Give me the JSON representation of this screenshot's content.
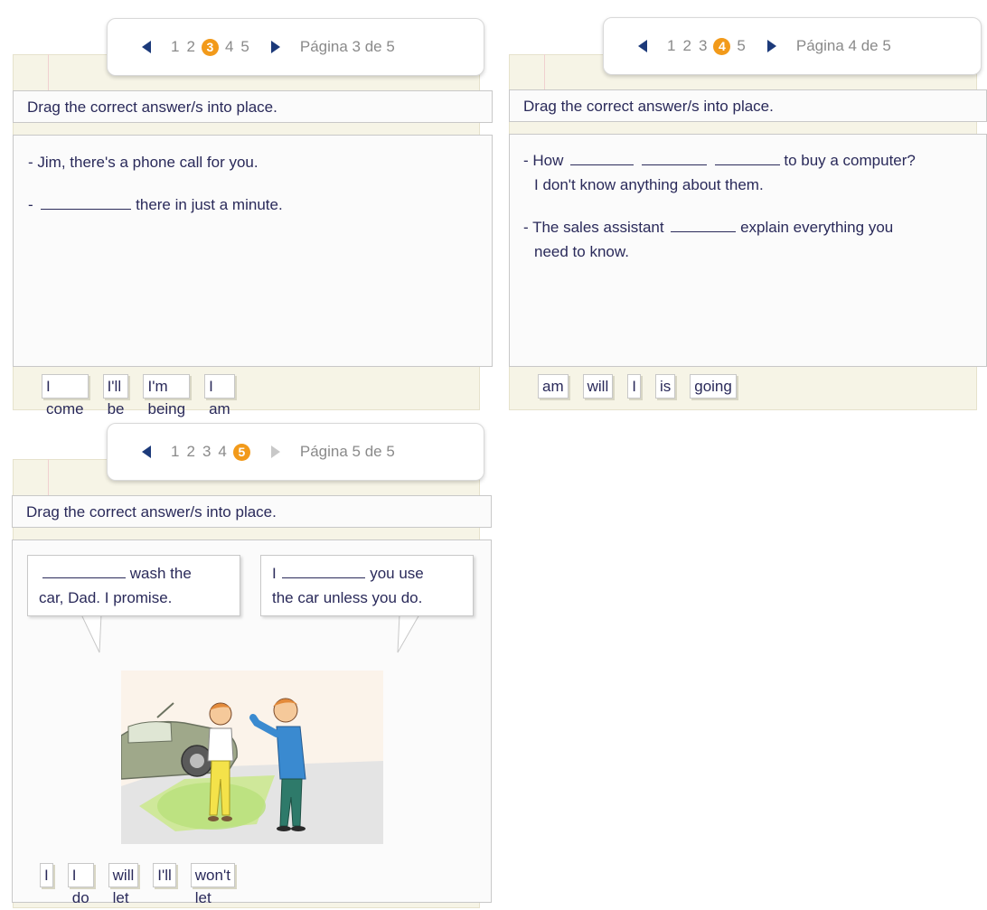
{
  "panel3": {
    "pager": {
      "pages": [
        "1",
        "2",
        "3",
        "4",
        "5"
      ],
      "current": "3",
      "label": "Página 3 de 5"
    },
    "instruction": "Drag the correct answer/s into place.",
    "line1": "- Jim, there's a phone call for you.",
    "line2_prefix": "-",
    "line2_suffix": "there in just a minute.",
    "chips": [
      "I come",
      "I'll be",
      "I'm being",
      "I am"
    ]
  },
  "panel4": {
    "pager": {
      "pages": [
        "1",
        "2",
        "3",
        "4",
        "5"
      ],
      "current": "4",
      "label": "Página 4 de 5"
    },
    "instruction": "Drag the correct answer/s into place.",
    "q1_prefix": "- How",
    "q1_suffix": "to buy a computer?",
    "q1_line2": "I don't know anything about them.",
    "q2_prefix": "- The sales assistant",
    "q2_suffix": "explain everything you",
    "q2_line2": "need to know.",
    "chips": [
      "am",
      "will",
      "I",
      "is",
      "going"
    ]
  },
  "panel5": {
    "pager": {
      "pages": [
        "1",
        "2",
        "3",
        "4",
        "5"
      ],
      "current": "5",
      "label": "Página 5 de 5"
    },
    "instruction": "Drag the correct answer/s into place.",
    "bubble_left_suffix": "wash the",
    "bubble_left_line2": "car, Dad. I promise.",
    "bubble_right_prefix": "I",
    "bubble_right_suffix": "you use",
    "bubble_right_line2": "the car unless you do.",
    "chips": [
      "I",
      "I do",
      "will let",
      "I'll",
      "won't let"
    ]
  },
  "colors": {
    "accent": "#f29a1a",
    "arrow": "#1c3a7a",
    "text": "#2a2a5a",
    "paper": "#f6f4e6"
  }
}
